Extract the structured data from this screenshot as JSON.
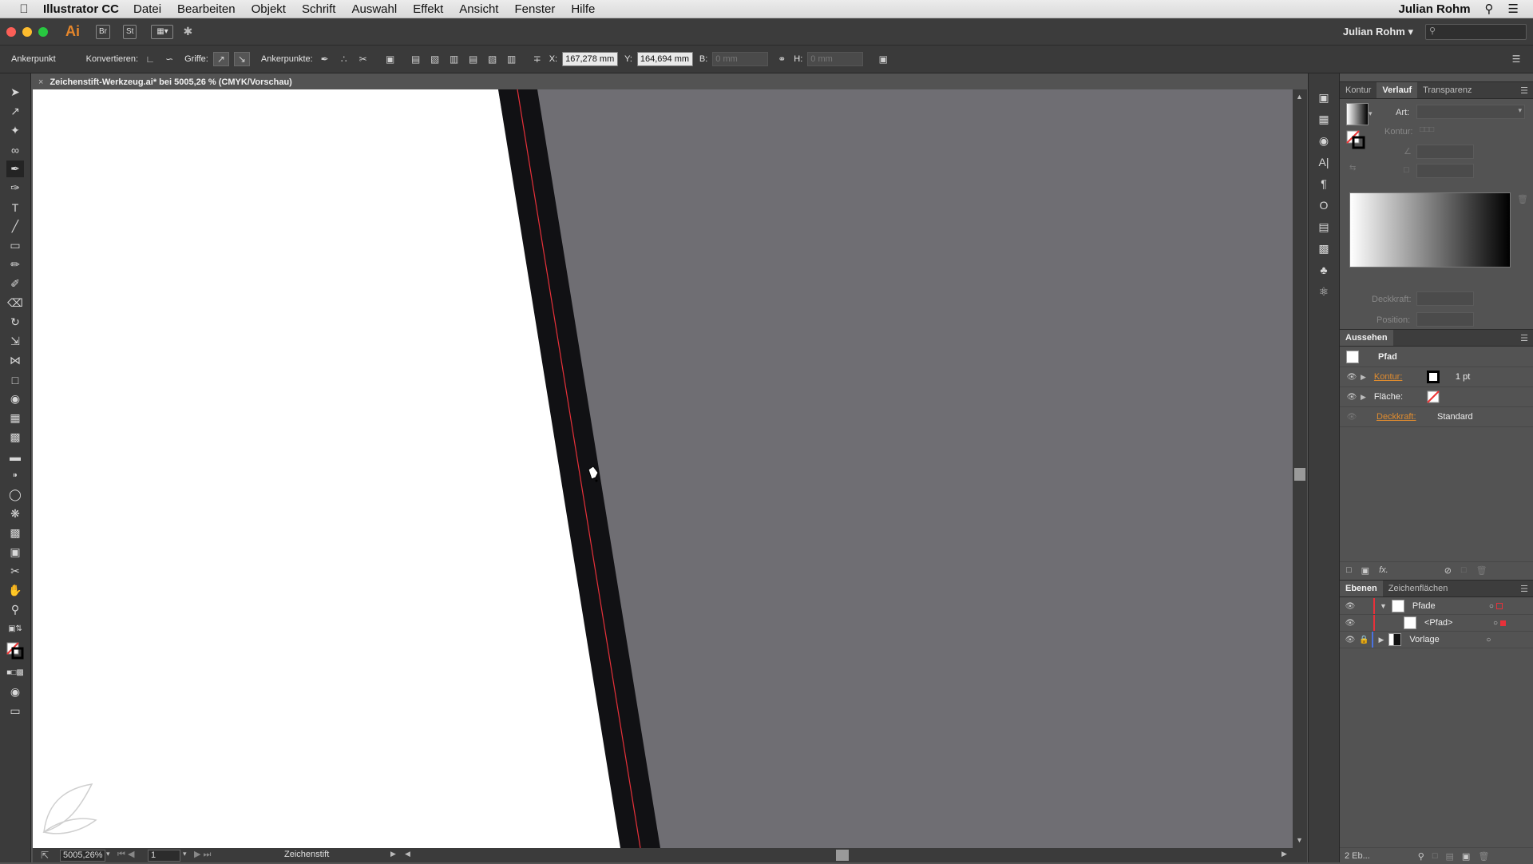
{
  "menubar": {
    "app": "Illustrator CC",
    "items": [
      "Datei",
      "Bearbeiten",
      "Objekt",
      "Schrift",
      "Auswahl",
      "Effekt",
      "Ansicht",
      "Fenster",
      "Hilfe"
    ],
    "user": "Julian Rohm"
  },
  "appbar": {
    "logo": "Ai",
    "bridge": "Br",
    "stock": "St",
    "user_menu": "Julian Rohm"
  },
  "control": {
    "mode": "Ankerpunkt",
    "convert": "Konvertieren:",
    "handles": "Griffe:",
    "anchors": "Ankerpunkte:",
    "x_label": "X:",
    "x_value": "167,278 mm",
    "y_label": "Y:",
    "y_value": "164,694 mm",
    "w_label": "B:",
    "w_value": "0 mm",
    "h_label": "H:",
    "h_value": "0 mm"
  },
  "document": {
    "title": "Zeichenstift-Werkzeug.ai* bei 5005,26 % (CMYK/Vorschau)"
  },
  "status": {
    "zoom": "5005,26%",
    "artboard": "1",
    "tool": "Zeichenstift"
  },
  "gradient_panel": {
    "tabs": [
      "Kontur",
      "Verlauf",
      "Transparenz"
    ],
    "art_label": "Art:",
    "kontur_label": "Kontur:",
    "opacity_label": "Deckkraft:",
    "position_label": "Position:"
  },
  "appearance_panel": {
    "title": "Aussehen",
    "object": "Pfad",
    "rows": [
      {
        "label": "Kontur:",
        "value": "1 pt"
      },
      {
        "label": "Fläche:",
        "value": ""
      },
      {
        "label": "Deckkraft:",
        "value": "Standard"
      }
    ],
    "fx": "fx."
  },
  "layers_panel": {
    "tabs": [
      "Ebenen",
      "Zeichenflächen"
    ],
    "layers": [
      {
        "name": "Pfade"
      },
      {
        "name": "<Pfad>"
      },
      {
        "name": "Vorlage"
      }
    ],
    "footer": "2 Eb..."
  },
  "colors": {
    "accent": "#e5862b",
    "stroke_red": "#e8313a",
    "path_black": "#111114",
    "canvas_gray": "#6f6e73"
  }
}
